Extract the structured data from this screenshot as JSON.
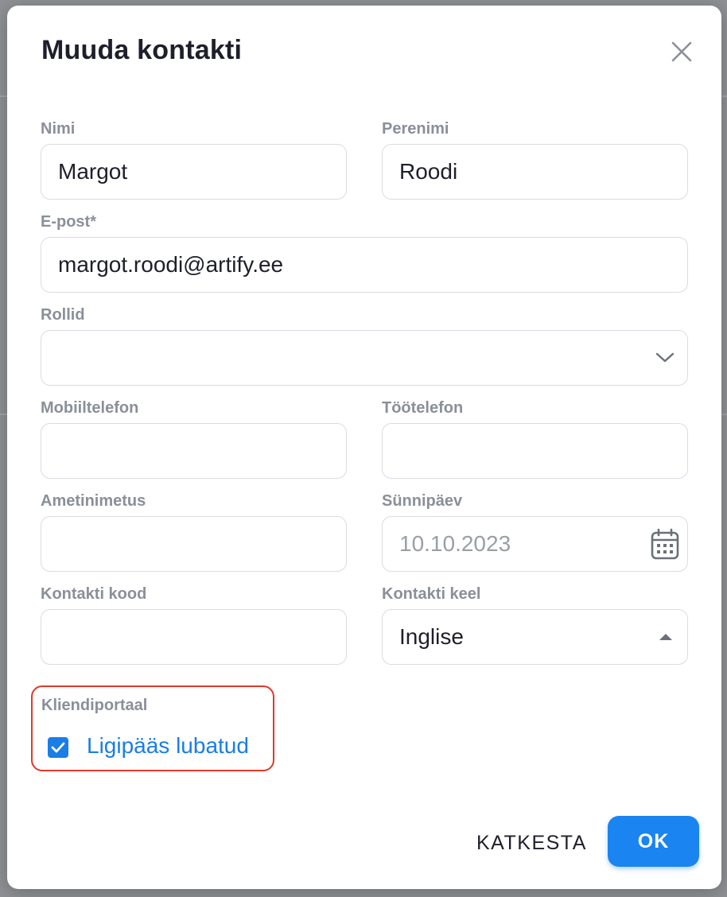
{
  "dialog": {
    "title": "Muuda kontakti"
  },
  "form": {
    "first_name": {
      "label": "Nimi",
      "value": "Margot"
    },
    "last_name": {
      "label": "Perenimi",
      "value": "Roodi"
    },
    "email": {
      "label": "E-post*",
      "value": "margot.roodi@artify.ee"
    },
    "roles": {
      "label": "Rollid",
      "value": ""
    },
    "mobile_phone": {
      "label": "Mobiiltelefon",
      "value": ""
    },
    "work_phone": {
      "label": "Töötelefon",
      "value": ""
    },
    "job_title": {
      "label": "Ametinimetus",
      "value": ""
    },
    "birthday": {
      "label": "Sünnipäev",
      "placeholder": "10.10.2023"
    },
    "contact_code": {
      "label": "Kontakti kood",
      "value": ""
    },
    "contact_language": {
      "label": "Kontakti keel",
      "value": "Inglise"
    },
    "client_portal": {
      "label": "Kliendiportaal",
      "checkbox_label": "Ligipääs lubatud",
      "checked": true
    }
  },
  "actions": {
    "cancel_label": "KATKESTA",
    "ok_label": "OK"
  },
  "colors": {
    "accent": "#1a84f0",
    "highlight": "#e0392c"
  },
  "icons": {
    "close": "close-icon",
    "roles_dropdown": "chevron-down-icon",
    "birthday": "calendar-icon",
    "language_dropdown": "caret-up-icon",
    "checkbox": "checkmark-icon"
  }
}
